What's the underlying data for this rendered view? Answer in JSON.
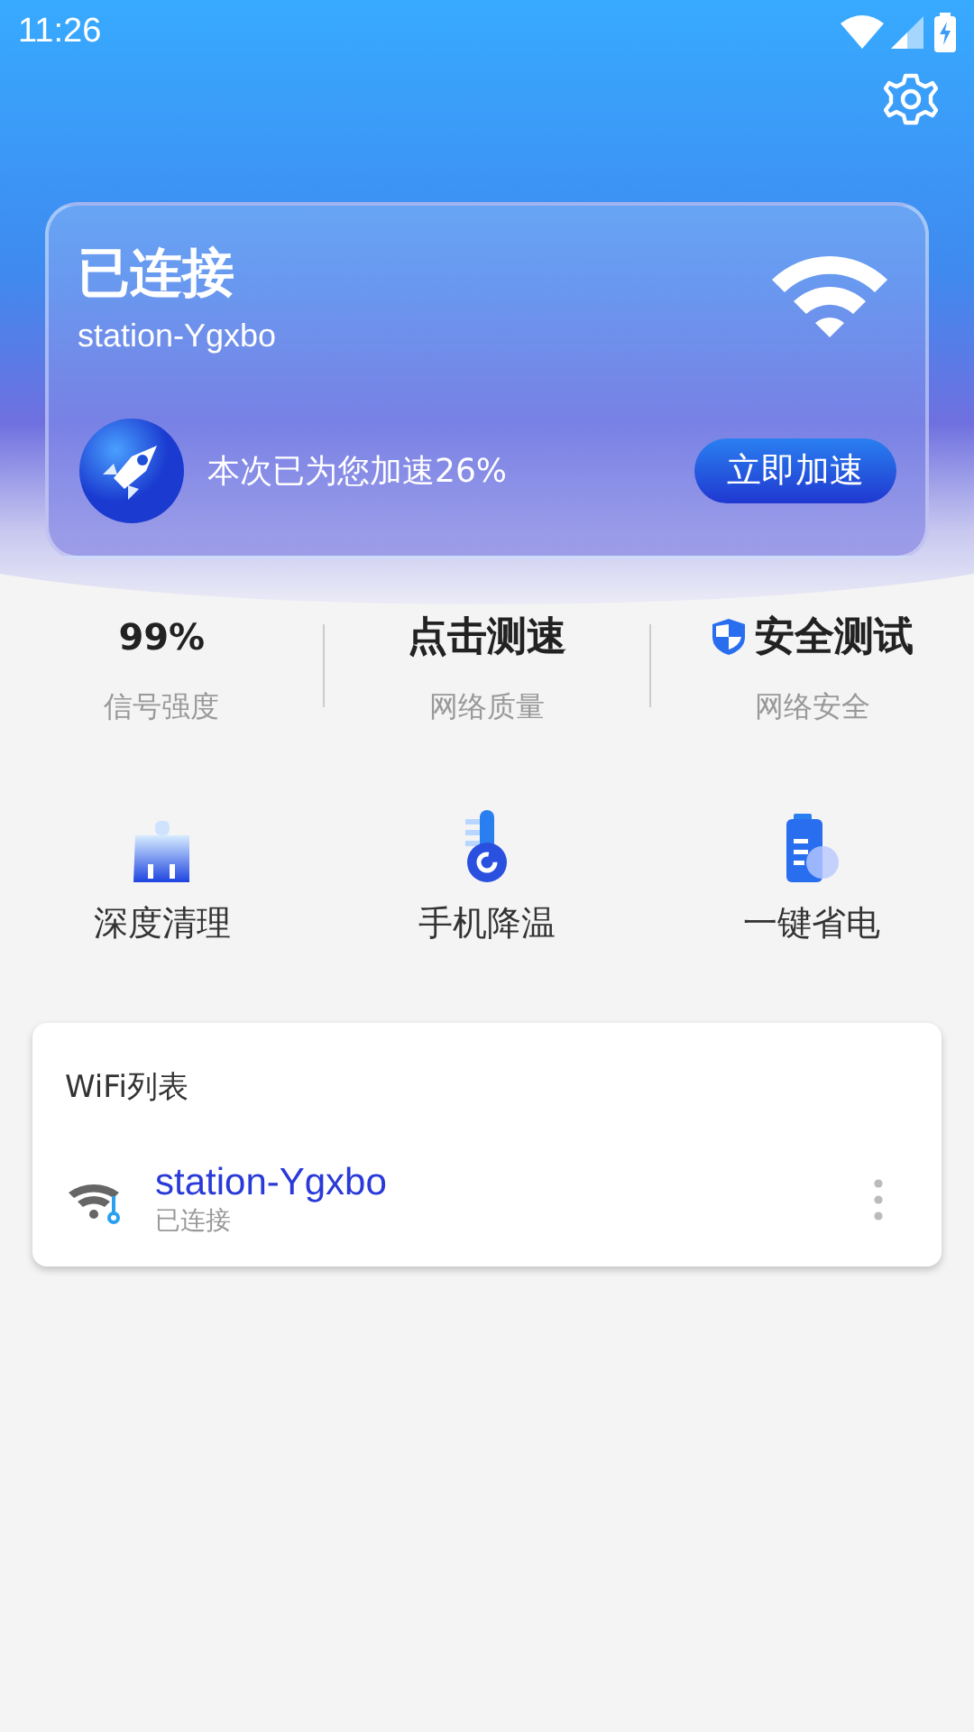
{
  "status_bar": {
    "time": "11:26"
  },
  "hero": {
    "title": "已连接",
    "ssid": "station-Ygxbo",
    "boost_text": "本次已为您加速26%",
    "boost_button": "立即加速"
  },
  "stats": [
    {
      "kind": "plain",
      "value": "99%",
      "label": "信号强度"
    },
    {
      "kind": "plain",
      "value": "点击测速",
      "label": "网络质量"
    },
    {
      "kind": "shield",
      "value": "安全测试",
      "label": "网络安全"
    }
  ],
  "tools": [
    {
      "kind": "broom",
      "label": "深度清理"
    },
    {
      "kind": "thermometer",
      "label": "手机降温"
    },
    {
      "kind": "battery",
      "label": "一键省电"
    }
  ],
  "wifi_list": {
    "title": "WiFi列表",
    "networks": [
      {
        "name": "station-Ygxbo",
        "status": "已连接",
        "connected": true
      }
    ]
  }
}
